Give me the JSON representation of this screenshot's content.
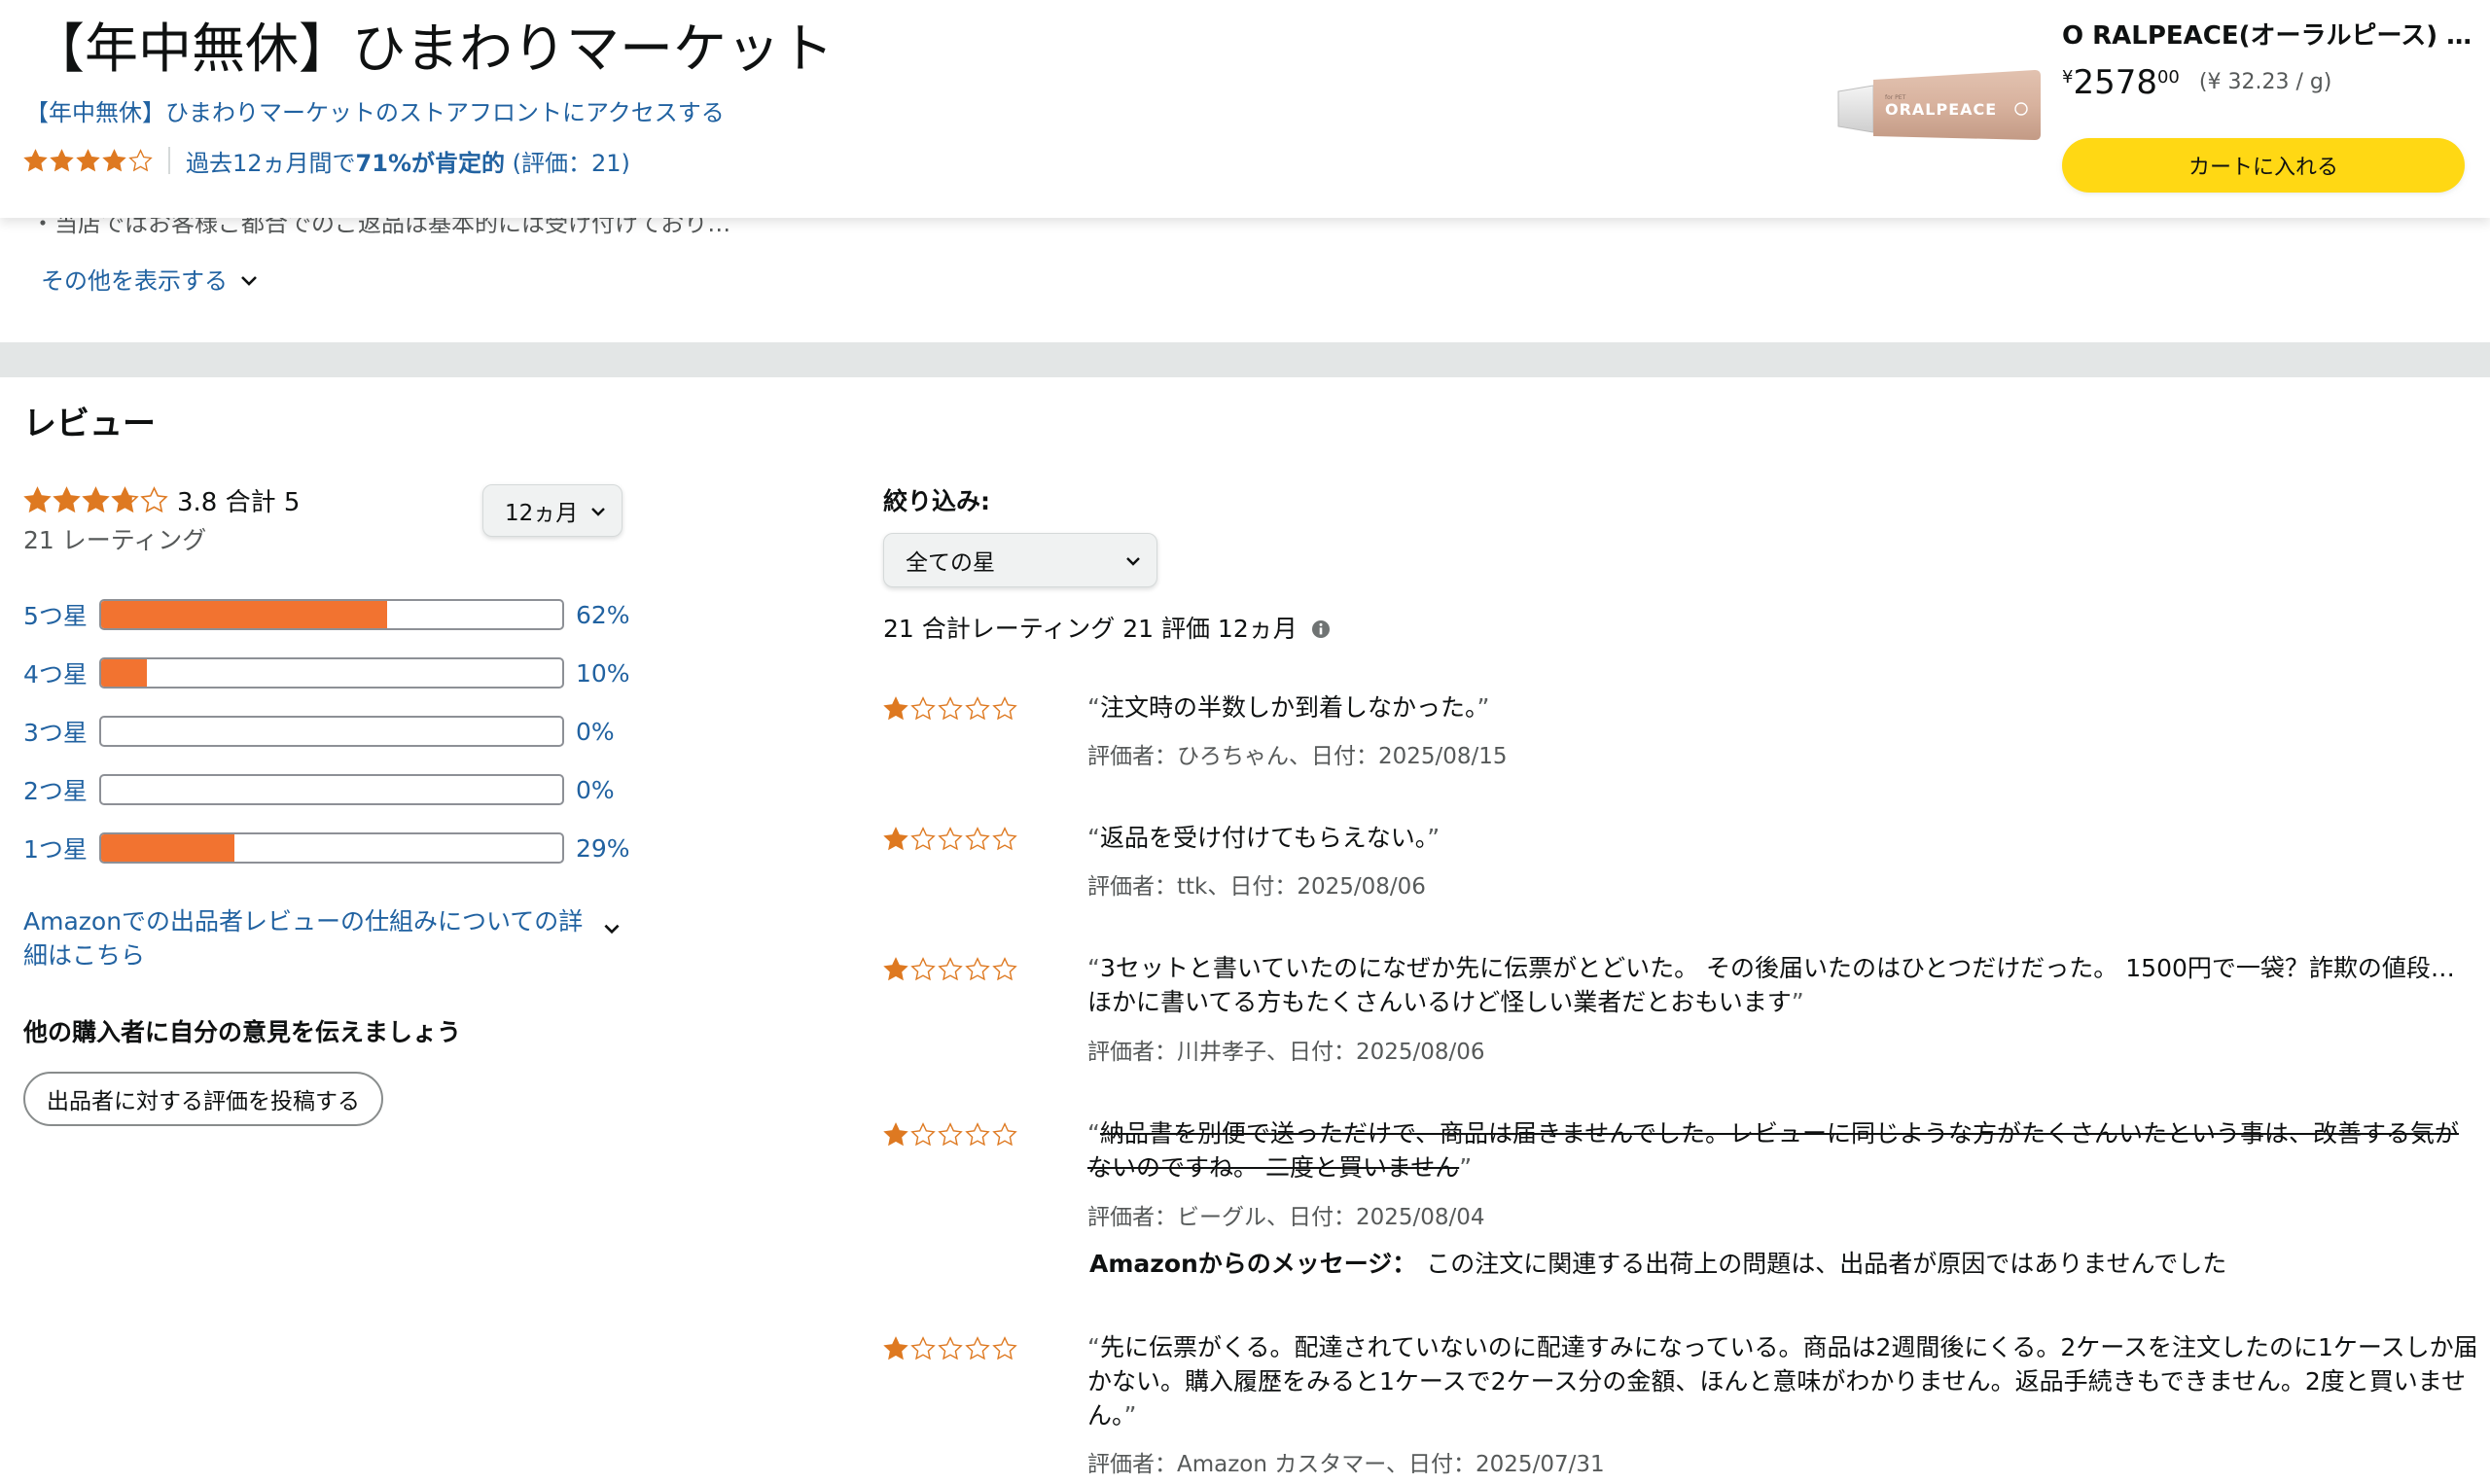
{
  "header": {
    "store_title": "【年中無休】ひまわりマーケット",
    "storefront_link": "【年中無休】ひまわりマーケットのストアフロントにアクセスする",
    "rating_stars": 4,
    "rating_prefix": "過去12ヵ月間で",
    "rating_positive": "71%が肯定的",
    "rating_suffix": " (評価：21)",
    "product": {
      "image_text": "ORALPEACE",
      "name": "O RALPEACE(オーラルピース) …",
      "price_symbol": "¥",
      "price_whole": "2578",
      "price_fraction": "00",
      "unit_price": "(¥ 32.23 / g)",
      "cart_button": "カートに入れる"
    }
  },
  "policy": {
    "truncated_text": "・当店ではお客様ご都合でのご返品は基本的には受け付けており…",
    "show_more": "その他を表示する"
  },
  "reviews": {
    "section_title": "レビュー",
    "summary": {
      "stars": 3.8,
      "avg_text": "3.8 合計  5",
      "rating_count": "21 レーティング",
      "period": "12ヵ月"
    },
    "histogram": [
      {
        "label": "5つ星",
        "percent": 62,
        "percent_text": "62%"
      },
      {
        "label": "4つ星",
        "percent": 10,
        "percent_text": "10%"
      },
      {
        "label": "3つ星",
        "percent": 0,
        "percent_text": "0%"
      },
      {
        "label": "2つ星",
        "percent": 0,
        "percent_text": "0%"
      },
      {
        "label": "1つ星",
        "percent": 29,
        "percent_text": "29%"
      }
    ],
    "how_it_works": "Amazonでの出品者レビューの仕組みについての詳細はこちら",
    "share_title": "他の購入者に自分の意見を伝えましょう",
    "post_button": "出品者に対する評価を投稿する",
    "filter_label": "絞り込み:",
    "star_filter": "全ての星",
    "totals": "21 合計レーティング 21 評価 12ヵ月",
    "items": [
      {
        "stars": 1,
        "text": "注文時の半数しか到着しなかった。",
        "meta": "評価者：ひろちゃん、日付：2025/08/15",
        "struck": false
      },
      {
        "stars": 1,
        "text": "返品を受け付けてもらえない。",
        "meta": "評価者：ttk、日付：2025/08/06",
        "struck": false
      },
      {
        "stars": 1,
        "text": "3セットと書いていたのになぜか先に伝票がとどいた。 その後届いたのはひとつだけだった。 1500円で一袋？詐欺の値段… ほかに書いてる方もたくさんいるけど怪しい業者だとおもいます",
        "meta": "評価者：川井孝子、日付：2025/08/06",
        "struck": false
      },
      {
        "stars": 1,
        "text": "納品書を別便で送っただけで、商品は届きませんでした。レビューに同じような方がたくさんいたという事は、改善する気がないのですね。 二度と買いません",
        "meta": "評価者：ビーグル、日付：2025/08/04",
        "struck": true
      },
      {
        "stars": 1,
        "text": "先に伝票がくる。配達されていないのに配達すみになっている。商品は2週間後にくる。2ケースを注文したのに1ケースしか届かない。購入履歴をみると1ケースで2ケース分の金額、ほんと意味がわかりません。返品手続きもできません。2度と買いません。",
        "meta": "評価者：Amazon カスタマー、日付：2025/07/31",
        "struck": false
      }
    ],
    "amazon_message": {
      "label": "Amazonからのメッセージ：",
      "text": "この注文に関連する出荷上の問題は、出品者が原因ではありませんでした"
    }
  },
  "colors": {
    "star": "#de7921",
    "bar_fill": "#f27330",
    "link": "#2162a1",
    "cart_button": "#ffd814",
    "band": "#e3e6e6"
  },
  "icons": [
    "star-icon",
    "chevron-down-icon",
    "info-icon"
  ]
}
